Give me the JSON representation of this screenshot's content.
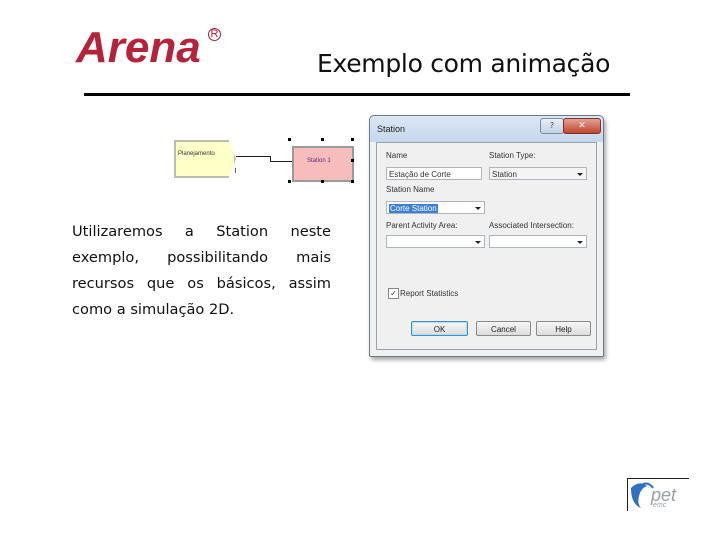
{
  "header": {
    "logo_text": "Arena",
    "logo_reg": "R",
    "title": "Exemplo com animação"
  },
  "flowchart": {
    "create_module_label": "Planejamento",
    "station_module_label": "Station 1",
    "colors": {
      "create_fill": "#ffffc8",
      "station_fill": "#f8bcbc"
    }
  },
  "body": {
    "paragraph": "Utilizaremos a Station neste exemplo, possibilitando mais recursos que os básicos, assim como a simulação 2D."
  },
  "dialog": {
    "title": "Station",
    "help_glyph": "?",
    "close_glyph": "✕",
    "labels": {
      "name": "Name",
      "station_type": "Station Type:",
      "station_name": "Station Name",
      "parent_activity_area": "Parent Activity Area:",
      "associated_intersection": "Associated Intersection:",
      "report_statistics": "Report Statistics"
    },
    "values": {
      "name": "Estação de Corte",
      "station_type": "Station",
      "station_name": "Corte Station",
      "parent_activity_area": "",
      "associated_intersection": "",
      "report_statistics_checked": true,
      "check_glyph": "✓"
    },
    "buttons": {
      "ok": "OK",
      "cancel": "Cancel",
      "help": "Help"
    }
  },
  "footer": {
    "logo_text": "pet",
    "logo_subtext": "emc"
  },
  "colors": {
    "brand_red": "#b4233a",
    "selection_blue": "#3b7fd6"
  }
}
